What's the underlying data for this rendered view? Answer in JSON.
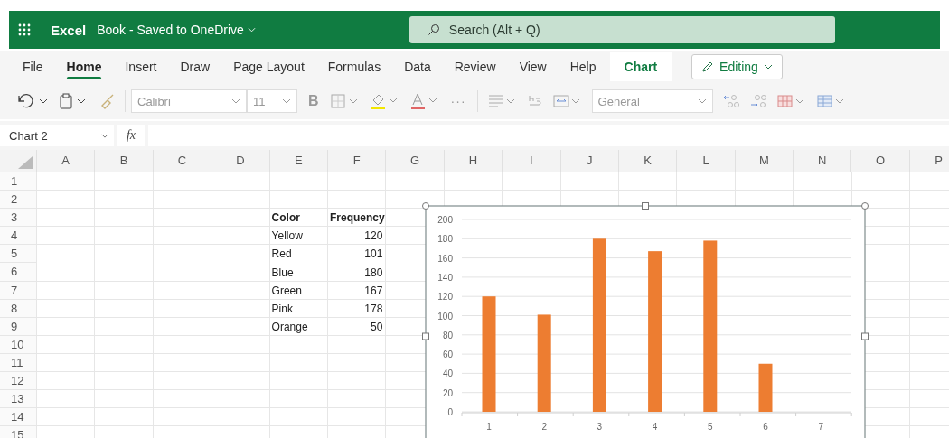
{
  "app_bar": {
    "app_name": "Excel",
    "document_title": "Book - Saved to OneDrive",
    "search": {
      "placeholder": "Search (Alt + Q)"
    }
  },
  "tabs": [
    {
      "label": "File",
      "selected": false,
      "kind": "normal"
    },
    {
      "label": "Home",
      "selected": true,
      "kind": "normal"
    },
    {
      "label": "Insert",
      "selected": false,
      "kind": "normal"
    },
    {
      "label": "Draw",
      "selected": false,
      "kind": "normal"
    },
    {
      "label": "Page Layout",
      "selected": false,
      "kind": "normal"
    },
    {
      "label": "Formulas",
      "selected": false,
      "kind": "normal"
    },
    {
      "label": "Data",
      "selected": false,
      "kind": "normal"
    },
    {
      "label": "Review",
      "selected": false,
      "kind": "normal"
    },
    {
      "label": "View",
      "selected": false,
      "kind": "normal"
    },
    {
      "label": "Help",
      "selected": false,
      "kind": "normal"
    },
    {
      "label": "Chart",
      "selected": false,
      "kind": "contextual"
    }
  ],
  "editing_button": {
    "label": "Editing"
  },
  "toolbar": {
    "font_name": "Calibri",
    "font_size": "11",
    "bold": "B",
    "more": "···",
    "number_format": "General"
  },
  "formula_bar": {
    "name_box": "Chart 2",
    "function_label": "fx"
  },
  "sheet": {
    "columns": [
      "A",
      "B",
      "C",
      "D",
      "E",
      "F",
      "G",
      "H",
      "I",
      "J",
      "K",
      "L",
      "M",
      "N",
      "O",
      "P"
    ],
    "rows": [
      "1",
      "2",
      "3",
      "4",
      "5",
      "6",
      "7",
      "8",
      "9",
      "10",
      "11",
      "12",
      "13",
      "14",
      "15"
    ],
    "data_table": {
      "header": [
        "Color",
        "Frequency"
      ],
      "rows": [
        [
          "Yellow",
          "120"
        ],
        [
          "Red",
          "101"
        ],
        [
          "Blue",
          "180"
        ],
        [
          "Green",
          "167"
        ],
        [
          "Pink",
          "178"
        ],
        [
          "Orange",
          "50"
        ]
      ]
    }
  },
  "chart": {
    "chart_data": {
      "type": "bar",
      "categories": [
        "1",
        "2",
        "3",
        "4",
        "5",
        "6",
        "7"
      ],
      "series": [
        {
          "color": "#ed7d31",
          "values": [
            120,
            101,
            180,
            167,
            178,
            50,
            null
          ]
        }
      ],
      "grid": true,
      "ylim": [
        0,
        200
      ],
      "yticks": [
        0,
        20,
        40,
        60,
        80,
        100,
        120,
        140,
        160,
        180,
        200
      ]
    }
  }
}
